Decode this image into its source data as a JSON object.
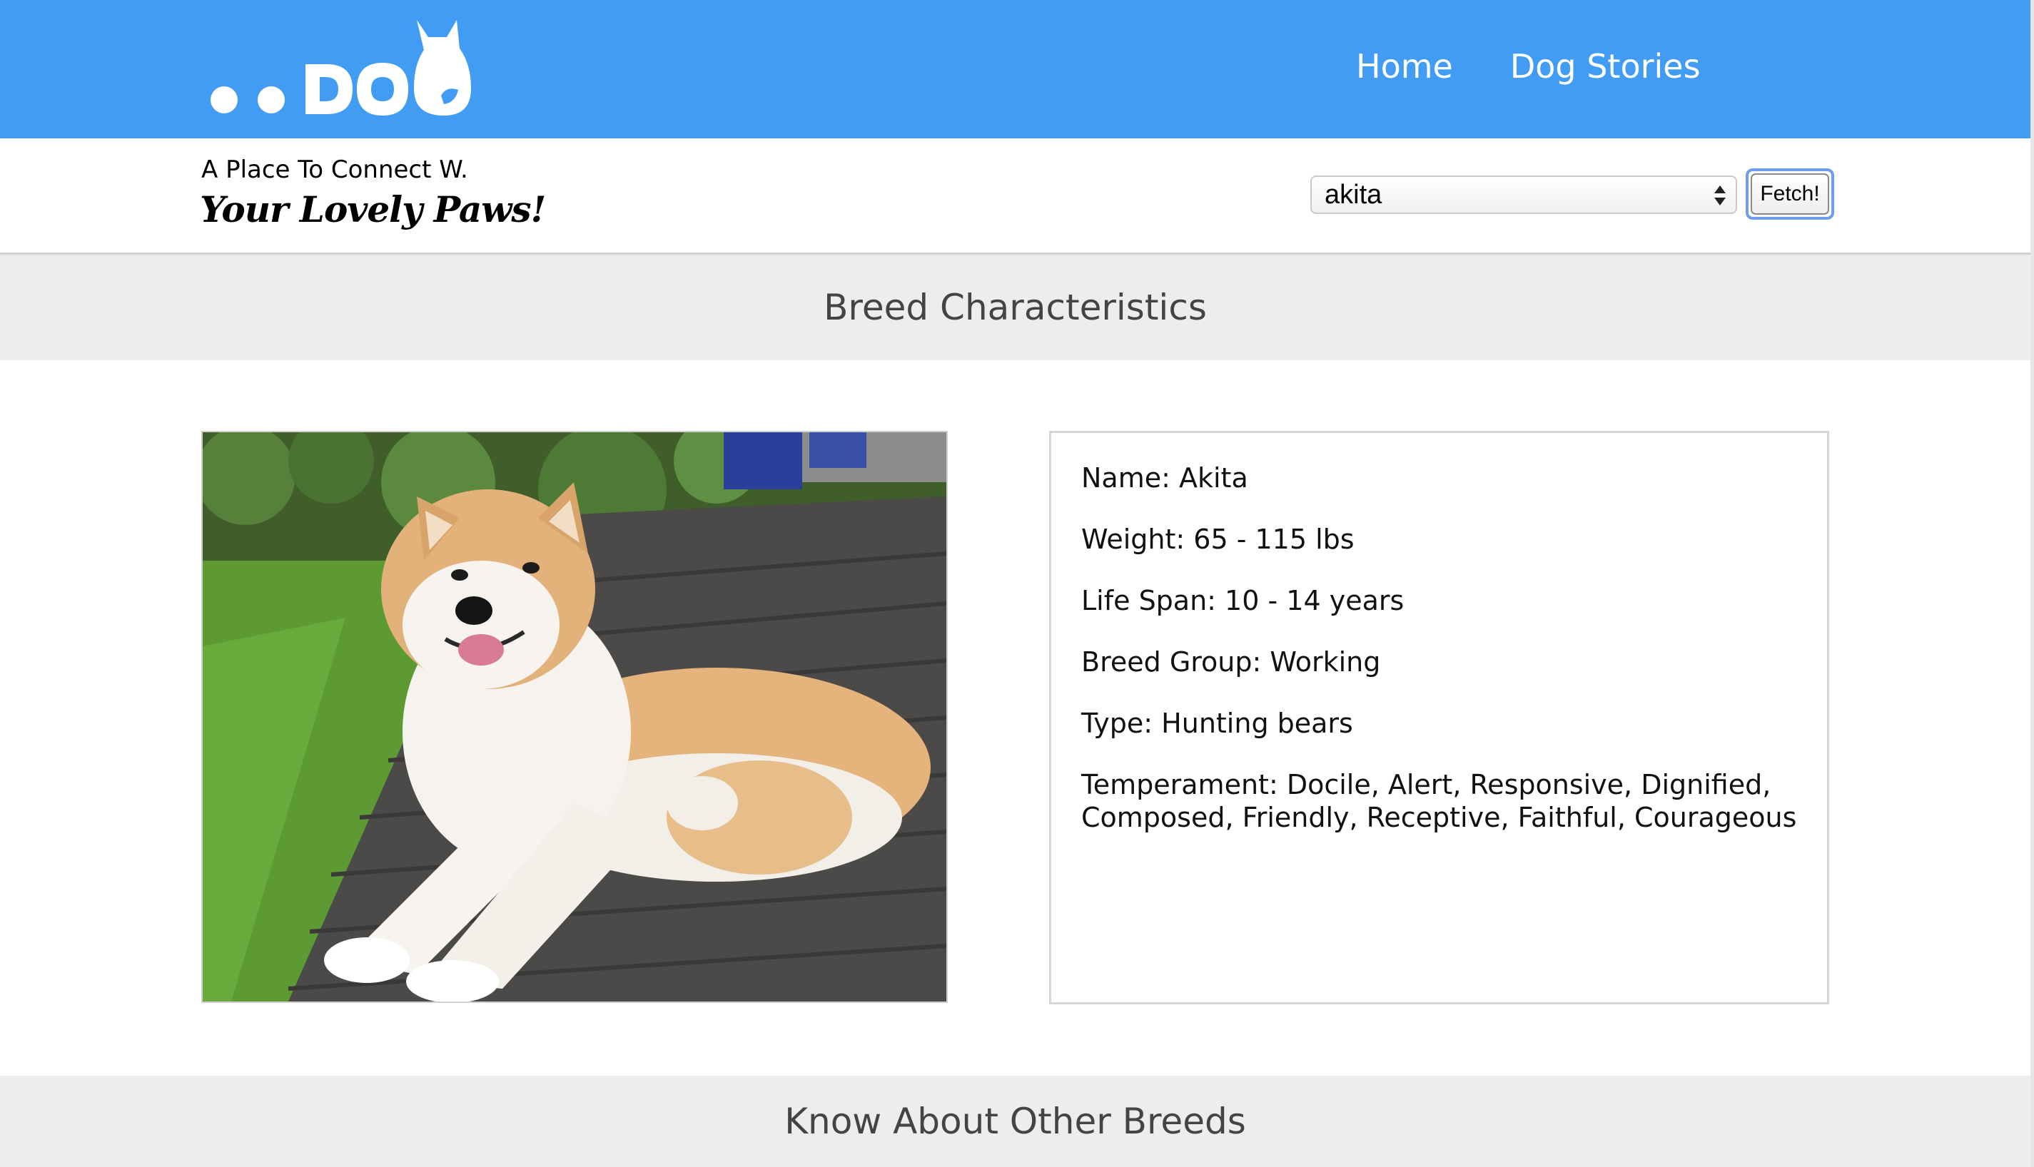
{
  "header": {
    "nav": [
      {
        "label": "Home"
      },
      {
        "label": "Dog Stories"
      }
    ],
    "logo_text": "..DOG"
  },
  "subbar": {
    "tagline_line1": "A Place To Connect W.",
    "tagline_line2": "Your Lovely Paws!",
    "breed_select": {
      "value": "akita"
    },
    "fetch_label": "Fetch!"
  },
  "sections": {
    "characteristics_title": "Breed Characteristics",
    "other_breeds_title": "Know About Other Breeds"
  },
  "breed": {
    "name": "Name: Akita",
    "weight": "Weight: 65 - 115 lbs",
    "life_span": "Life Span: 10 - 14 years",
    "breed_group": "Breed Group: Working",
    "type": "Type: Hunting bears",
    "temperament": "Temperament: Docile, Alert, Responsive, Dignified, Composed, Friendly, Receptive, Faithful, Courageous"
  },
  "colors": {
    "header_blue": "#429cf3",
    "band_gray": "#ededed",
    "title_gray": "#444444"
  }
}
